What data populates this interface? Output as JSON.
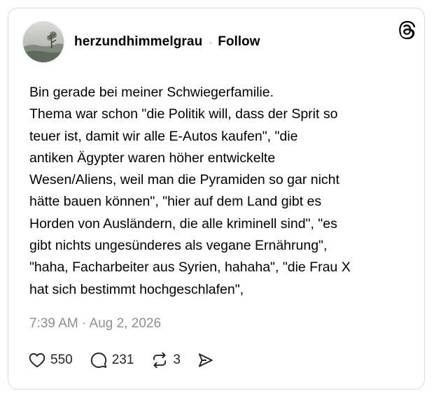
{
  "post": {
    "username": "herzundhimmelgrau",
    "separator": "·",
    "follow_label": "Follow",
    "text": "Bin gerade bei meiner Schwiegerfamilie.\nThema war schon \"die Politik will, dass der Sprit so\nteuer ist, damit wir alle E-Autos kaufen\", \"die\nantiken Ägypter waren höher entwickelte\nWesen/Aliens, weil man die Pyramiden so gar nicht\nhätte bauen können\", \"hier auf dem Land gibt es\nHorden von Ausländern, die alle kriminell sind\", \"es\ngibt nichts ungesünderes als vegane Ernährung\",\n\"haha, Facharbeiter aus Syrien, hahaha\", \"die Frau X\nhat sich bestimmt hochgeschlafen\",",
    "timestamp": "7:39 AM · Aug 2, 2026"
  },
  "stats": {
    "likes": "550",
    "replies": "231",
    "reposts": "3"
  },
  "icons": {
    "platform_logo": "threads-logo-icon",
    "like": "heart-icon",
    "reply": "speech-bubble-icon",
    "repost": "repost-arrows-icon",
    "share": "send-icon"
  },
  "colors": {
    "text": "#000000",
    "muted": "#8e8e8e",
    "border": "#dbdbdb"
  }
}
